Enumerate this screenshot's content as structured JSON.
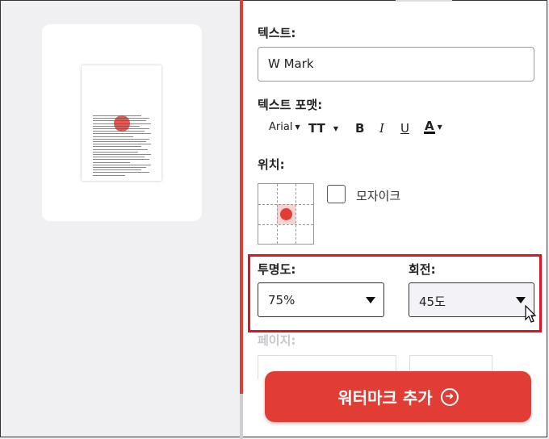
{
  "text_field": {
    "label": "텍스트:",
    "value": "W Mark"
  },
  "text_format": {
    "label": "텍스트 포맷:",
    "font": "Arial",
    "size_glyph": "TT",
    "bold": "B",
    "italic": "I",
    "underline": "U",
    "color": "A"
  },
  "position": {
    "label": "위치:",
    "mosaic_label": "모자이크",
    "mosaic_checked": false
  },
  "opacity": {
    "label": "투명도:",
    "selected": "75%"
  },
  "rotation": {
    "label": "회전:",
    "selected": "45도"
  },
  "pages": {
    "label": "페이지:"
  },
  "add_button": {
    "label": "워터마크 추가"
  },
  "colors": {
    "accent": "#e23d34",
    "highlight_box": "#e2121f"
  }
}
